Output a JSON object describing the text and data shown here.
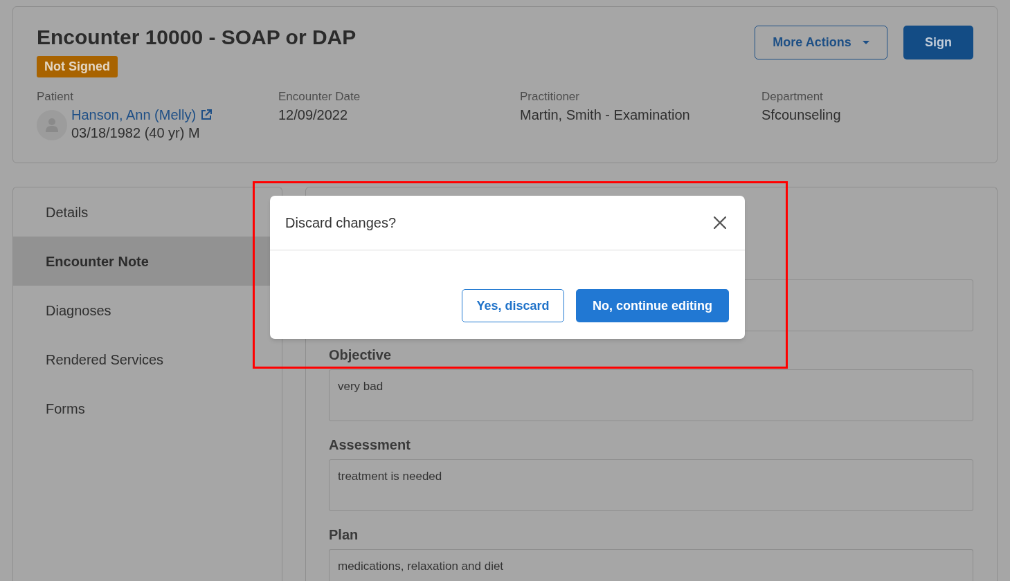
{
  "encounter": {
    "title": "Encounter 10000 - SOAP or DAP",
    "status_badge": "Not Signed",
    "actions": [
      {
        "label": "More Actions",
        "kind": "dropdown"
      },
      {
        "label": "Sign",
        "kind": "primary"
      }
    ],
    "details": [
      {
        "kind": "patient",
        "label": "Patient",
        "name": "Hanson, Ann (Melly)",
        "value": "03/18/1982 (40 yr) M"
      },
      {
        "kind": "text",
        "label": "Encounter Date",
        "value": "12/09/2022"
      },
      {
        "kind": "text",
        "label": "Practitioner",
        "value": "Martin, Smith - Examination"
      },
      {
        "kind": "text",
        "label": "Department",
        "value": "Sfcounseling"
      }
    ]
  },
  "sidebar": {
    "items": [
      {
        "label": "Details",
        "selected": false
      },
      {
        "label": "Encounter Note",
        "selected": true
      },
      {
        "label": "Diagnoses",
        "selected": false
      },
      {
        "label": "Rendered Services",
        "selected": false
      },
      {
        "label": "Forms",
        "selected": false
      }
    ]
  },
  "note": {
    "fields": [
      {
        "kind": "covered"
      },
      {
        "kind": "field",
        "label": "Objective",
        "value": "very bad"
      },
      {
        "kind": "field",
        "label": "Assessment",
        "value": "treatment is needed"
      },
      {
        "kind": "field",
        "label": "Plan",
        "value": "medications, relaxation and diet"
      }
    ]
  },
  "dialog": {
    "title": "Discard changes?",
    "buttons": [
      {
        "label": "Yes, discard",
        "kind": "secondary"
      },
      {
        "label": "No, continue editing",
        "kind": "primary"
      }
    ]
  },
  "annotation": {
    "kind": "frame"
  }
}
